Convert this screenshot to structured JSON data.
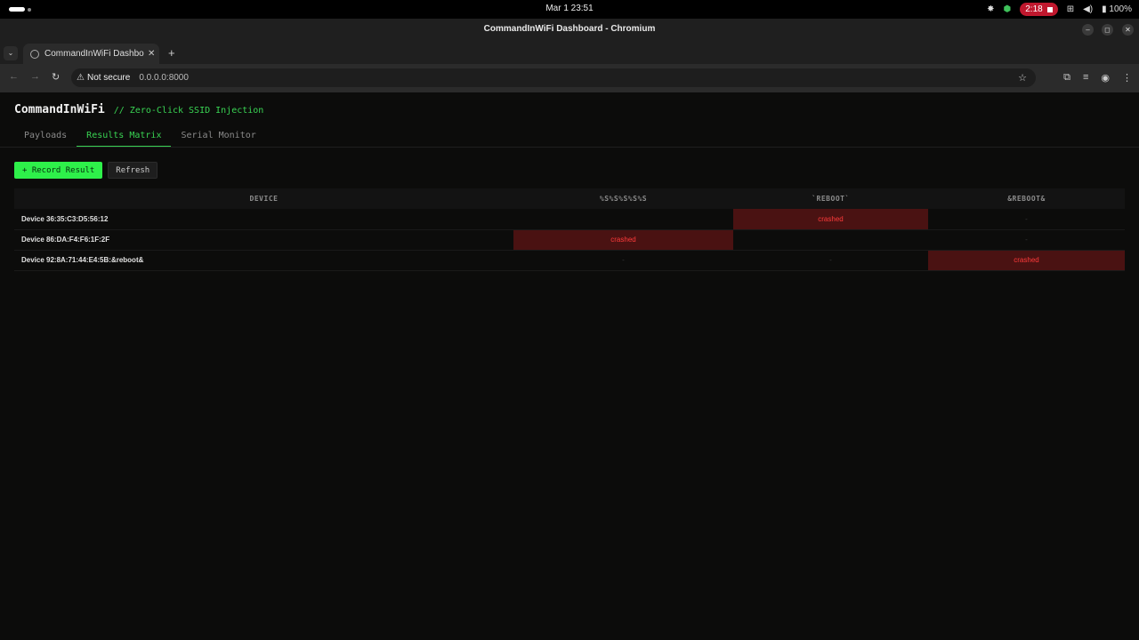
{
  "system": {
    "clock": "Mar 1  23:51",
    "recording_time": "2:18",
    "battery": "100%"
  },
  "window": {
    "title": "CommandInWiFi Dashboard - Chromium",
    "tab_title": "CommandInWiFi Dashbo",
    "security_label": "Not secure",
    "url": "0.0.0.0:8000"
  },
  "app": {
    "brand": "CommandInWiFi",
    "subtitle": "// Zero-Click SSID Injection",
    "tabs": [
      {
        "label": "Payloads",
        "active": false
      },
      {
        "label": "Results Matrix",
        "active": true
      },
      {
        "label": "Serial Monitor",
        "active": false
      }
    ],
    "record_button": "+ Record Result",
    "refresh_button": "Refresh"
  },
  "matrix": {
    "headers": [
      "DEVICE",
      "%S%S%S%S%S",
      "`REBOOT`",
      "&REBOOT&"
    ],
    "rows": [
      {
        "device": "Device 36:35:C3:D5:56:12",
        "cells": [
          "",
          "crashed",
          "-"
        ]
      },
      {
        "device": "Device 86:DA:F4:F6:1F:2F",
        "cells": [
          "crashed",
          "",
          "-"
        ]
      },
      {
        "device": "Device 92:8A:71:44:E4:5B:&reboot&",
        "cells": [
          "-",
          "-",
          "crashed"
        ]
      }
    ]
  }
}
